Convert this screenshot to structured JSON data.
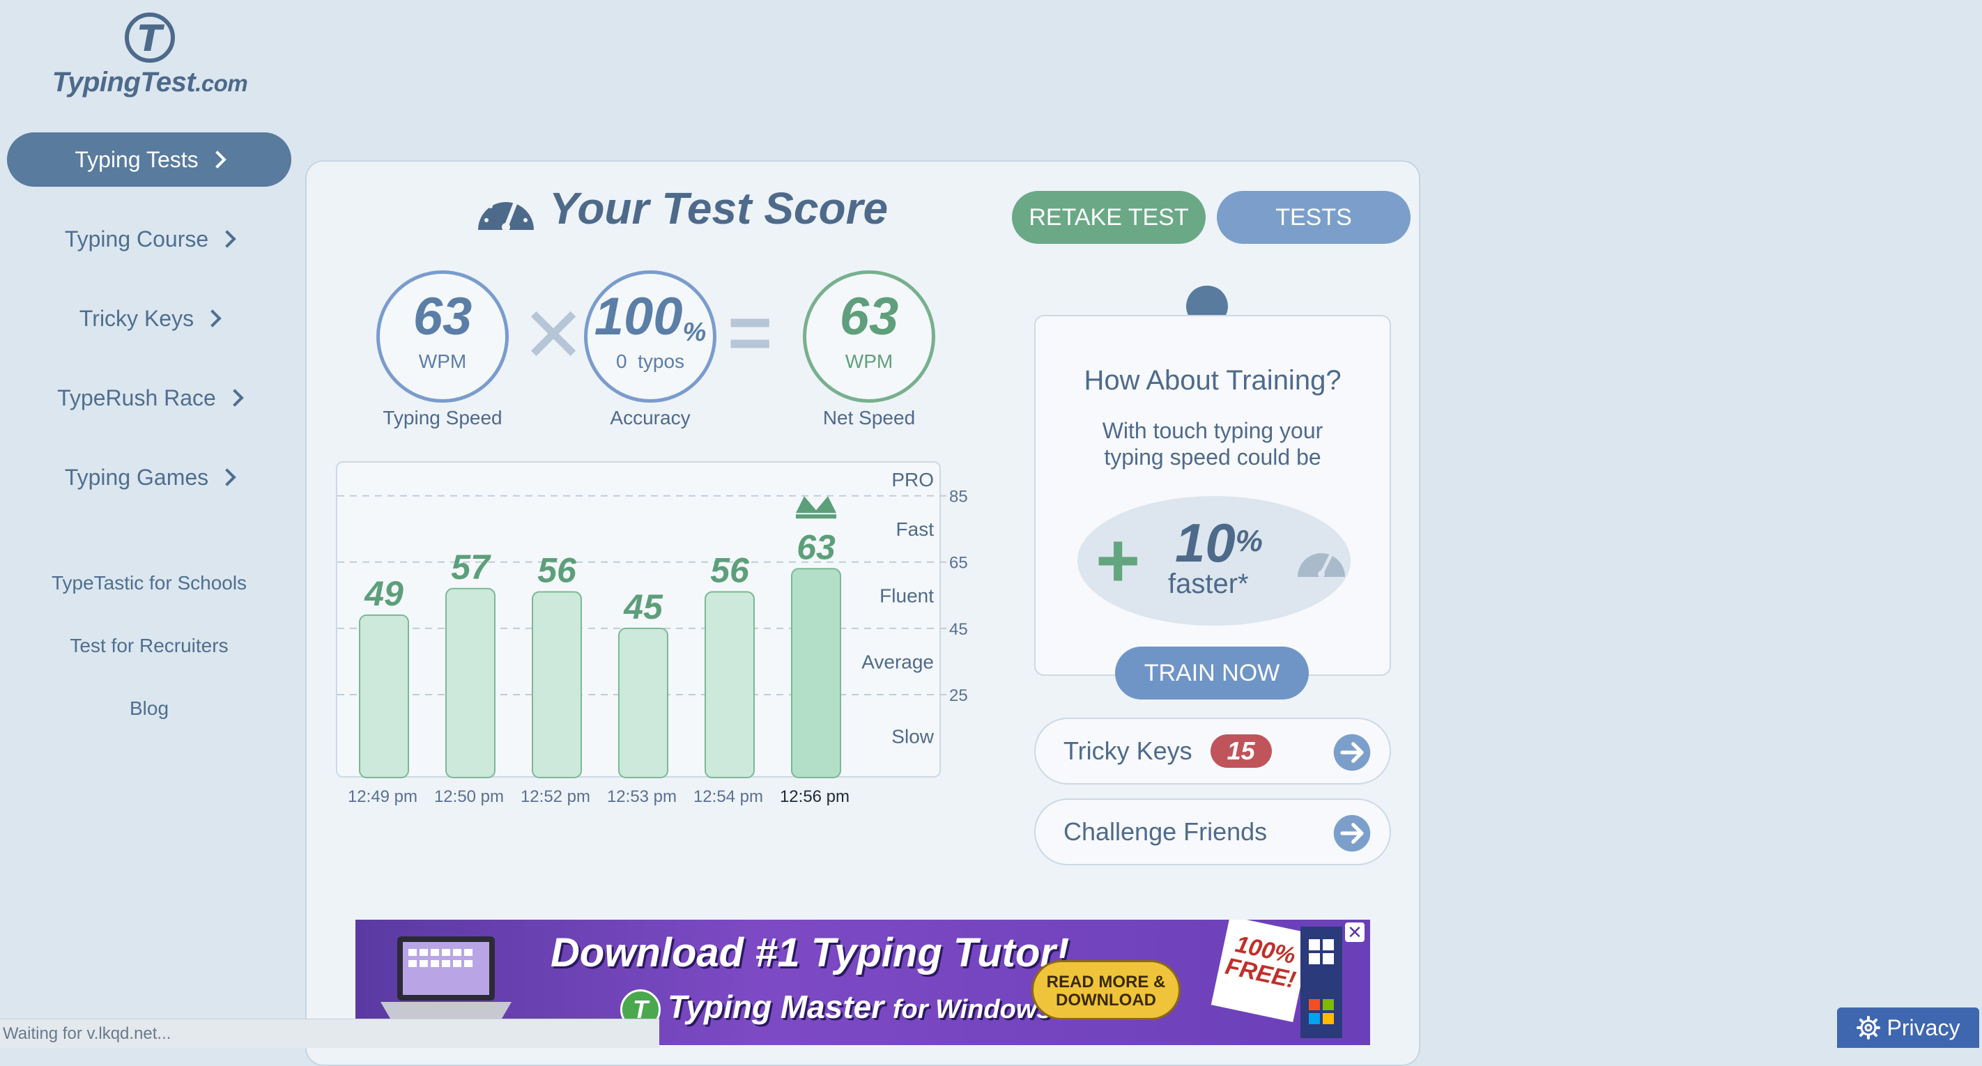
{
  "logo": {
    "mark": "T",
    "name": "TypingTest",
    "tld": ".com"
  },
  "nav": {
    "items": [
      {
        "label": "Typing Tests",
        "active": true
      },
      {
        "label": "Typing Course"
      },
      {
        "label": "Tricky Keys"
      },
      {
        "label": "TypeRush Race"
      },
      {
        "label": "Typing Games"
      }
    ],
    "links": [
      "TypeTastic for Schools",
      "Test for Recruiters",
      "Blog"
    ]
  },
  "score": {
    "title": "Your Test Score",
    "retake_label": "RETAKE TEST",
    "tests_label": "TESTS",
    "typing_speed": {
      "value": "63",
      "unit": "WPM",
      "label": "Typing Speed"
    },
    "accuracy": {
      "value": "100",
      "unit": "%",
      "typos": "0",
      "typos_label": "typos",
      "label": "Accuracy"
    },
    "net_speed": {
      "value": "63",
      "unit": "WPM",
      "label": "Net Speed"
    },
    "times_op": "✕",
    "equals_op": "="
  },
  "chart_data": {
    "type": "bar",
    "categories": [
      "12:49 pm",
      "12:50 pm",
      "12:52 pm",
      "12:53 pm",
      "12:54 pm",
      "12:56 pm"
    ],
    "values": [
      49,
      57,
      56,
      45,
      56,
      63
    ],
    "highlight_index": 5,
    "ylim": [
      0,
      95
    ],
    "yticks": [
      25,
      45,
      65,
      85
    ],
    "bands": [
      {
        "label": "PRO",
        "y": 90
      },
      {
        "label": "Fast",
        "y": 75
      },
      {
        "label": "Fluent",
        "y": 55
      },
      {
        "label": "Average",
        "y": 35
      },
      {
        "label": "Slow",
        "y": 12.5
      }
    ],
    "gridlines": "dashed at ticks",
    "colors": {
      "bar": "#cde9db",
      "bar_latest": "#b3dfc8",
      "bar_border": "#7ab896",
      "value": "#5c9f7a"
    }
  },
  "training": {
    "title": "How About Training?",
    "text_line1": "With touch typing your",
    "text_line2": "typing speed could be",
    "plus": "+",
    "percent": "10",
    "percent_sign": "%",
    "faster": "faster*",
    "button": "TRAIN NOW"
  },
  "tricky_keys": {
    "label": "Tricky Keys",
    "count": "15"
  },
  "challenge": {
    "label": "Challenge Friends"
  },
  "ad": {
    "title": "Download #1 Typing Tutor!",
    "sub_brand": "Typing Master",
    "sub_rest": "for Windows",
    "btn_line1": "READ MORE &",
    "btn_line2": "DOWNLOAD",
    "free_line1": "100%",
    "free_line2": "FREE!",
    "close": "✕"
  },
  "status": "Waiting for v.lkqd.net...",
  "privacy": "Privacy",
  "colors": {
    "accent_blue": "#587b9e",
    "accent_green": "#6aa886",
    "badge_red": "#c0545b",
    "background": "#dce6ef"
  }
}
